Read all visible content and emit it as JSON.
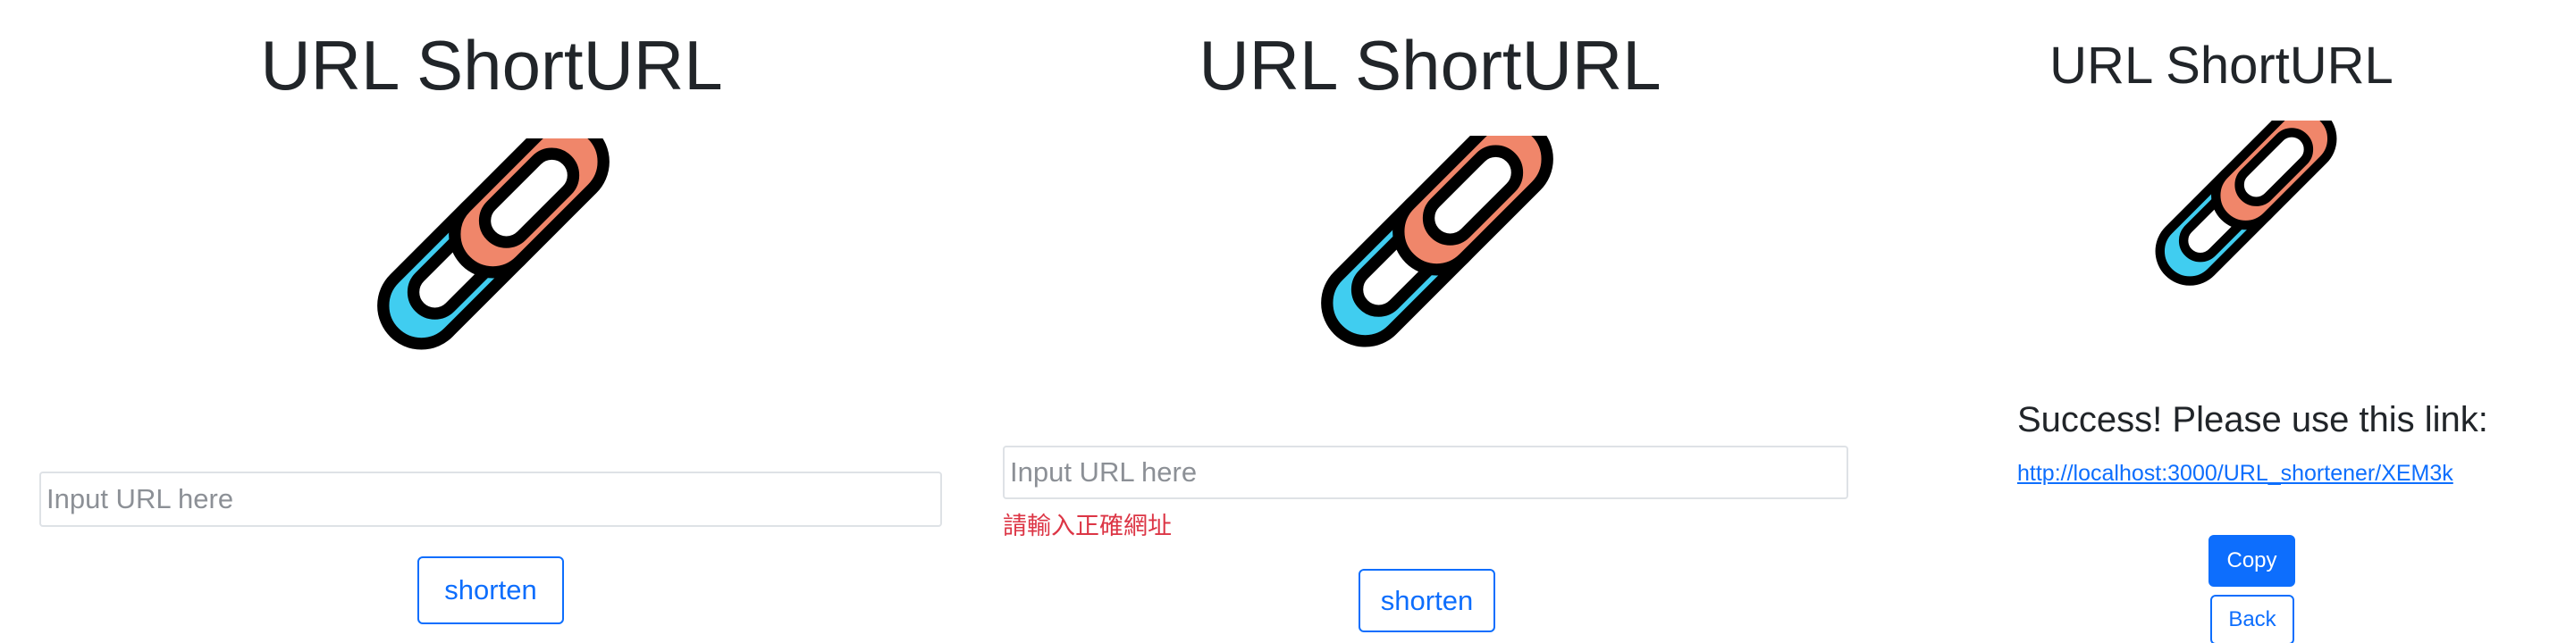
{
  "colors": {
    "primary": "#0d6efd",
    "error": "#dc3545",
    "link_left": "#40cdf0",
    "link_right": "#f0866a",
    "outline": "#000000",
    "input_border": "#dee2e6"
  },
  "panels": [
    {
      "state": "empty-form",
      "title": "URL ShortURL",
      "logo_icon": "chain-link-icon",
      "input": {
        "value": "",
        "placeholder": "Input URL here"
      },
      "shorten_label": "shorten"
    },
    {
      "state": "validation-error",
      "title": "URL ShortURL",
      "logo_icon": "chain-link-icon",
      "input": {
        "value": "",
        "placeholder": "Input URL here"
      },
      "error_message": "請輸入正確網址",
      "shorten_label": "shorten"
    },
    {
      "state": "success",
      "title": "URL ShortURL",
      "logo_icon": "chain-link-icon",
      "success_message": "Success! Please use this link:",
      "short_url": "http://localhost:3000/URL_shortener/XEM3k",
      "copy_label": "Copy",
      "back_label": "Back"
    }
  ]
}
